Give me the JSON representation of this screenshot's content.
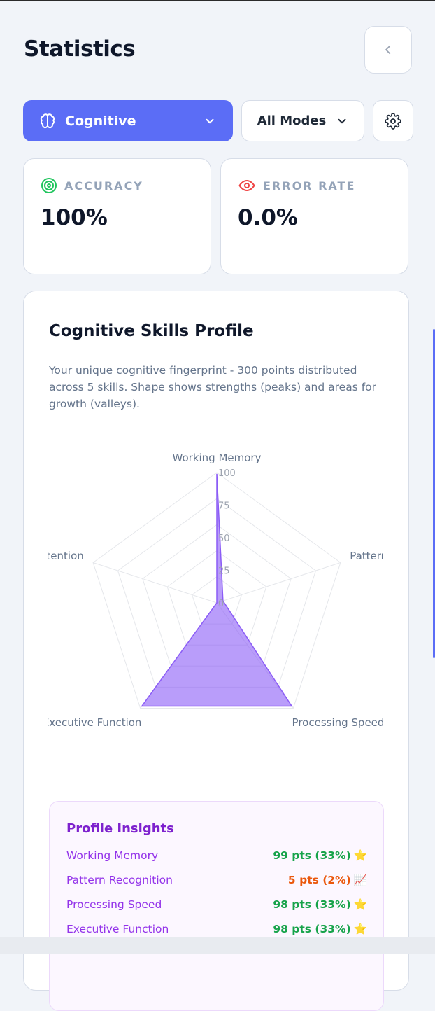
{
  "header": {
    "title": "Statistics"
  },
  "filters": {
    "category_label": "Cognitive",
    "mode_label": "All Modes"
  },
  "stats": {
    "accuracy": {
      "label": "ACCURACY",
      "value": "100%",
      "color": "#22c55e"
    },
    "error_rate": {
      "label": "ERROR RATE",
      "value": "0.0%",
      "color": "#ef4444"
    }
  },
  "profile": {
    "title": "Cognitive Skills Profile",
    "description": "Your unique cognitive fingerprint - 300 points distributed across 5 skills. Shape shows strengths (peaks) and areas for growth (valleys).",
    "axis_labels": [
      "Working Memory",
      "Pattern Recognition",
      "Processing Speed",
      "Executive Function",
      "Attention"
    ],
    "ticks": [
      "0",
      "25",
      "50",
      "75",
      "100"
    ],
    "fill_color": "#8b5cf6",
    "chart_data": {
      "type": "radar",
      "categories": [
        "Working Memory",
        "Pattern Recognition",
        "Processing Speed",
        "Executive Function",
        "Attention"
      ],
      "values": [
        99,
        5,
        98,
        98,
        0
      ],
      "rlim": [
        0,
        100
      ]
    }
  },
  "insights": {
    "title": "Profile Insights",
    "rows": [
      {
        "name": "Working Memory",
        "pts": "99 pts (33%)",
        "icon": "star-icon",
        "status": "good"
      },
      {
        "name": "Pattern Recognition",
        "pts": "5 pts (2%)",
        "icon": "chart-up-icon",
        "status": "low"
      },
      {
        "name": "Processing Speed",
        "pts": "98 pts (33%)",
        "icon": "star-icon",
        "status": "good"
      },
      {
        "name": "Executive Function",
        "pts": "98 pts (33%)",
        "icon": "star-icon",
        "status": "good"
      }
    ]
  }
}
